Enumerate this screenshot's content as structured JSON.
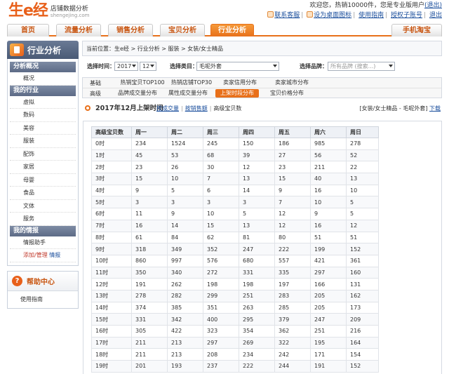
{
  "header": {
    "logo_main": "生e经",
    "logo_sub1": "店铺数据分析",
    "logo_sub2": "shengejing.com",
    "welcome": "欢迎您，热销10000件，您是专业版用户",
    "welcome_link": "(退出)",
    "links": [
      "联系客服",
      "设为桌面图标",
      "使用指南",
      "授权子账号",
      "退出"
    ]
  },
  "nav": {
    "tabs": [
      "首页",
      "流量分析",
      "销售分析",
      "宝贝分析",
      "行业分析"
    ],
    "active": "行业分析",
    "right_tab": "手机淘宝"
  },
  "sidebar": {
    "title": "行业分析",
    "groups": [
      {
        "head": "分析概况",
        "items": [
          "概况"
        ]
      },
      {
        "head": "我的行业",
        "items": [
          "虚拟",
          "数码",
          "美容",
          "服装",
          "配饰",
          "家居",
          "母婴",
          "食品",
          "文体",
          "服务"
        ]
      },
      {
        "head": "我的情报",
        "items": [
          "情报助手"
        ]
      }
    ],
    "add_manage": "添加/管理",
    "add_manage_link": "情报"
  },
  "help": {
    "icon": "?",
    "title": "帮助中心",
    "item": "使用指南"
  },
  "breadcrumb": "当前位置：生e经 > 行业分析 > 服装 > 女装/女士精品",
  "filters": {
    "time_label": "选择时间：",
    "year": "2017",
    "month": "12",
    "category_label": "选择类目：",
    "category": "毛呢外套",
    "brand_label": "选择品牌：",
    "brand_placeholder": "所有品牌 (搜索...)"
  },
  "subtabs": {
    "basic_label": "基础",
    "basic": [
      "热销宝贝TOP100",
      "热销店铺TOP30",
      "卖家信用分布",
      "卖家城市分布"
    ],
    "advanced_label": "高级",
    "advanced": [
      "品牌成交量分布",
      "属性成交量分布",
      "上架时段分布",
      "宝贝价格分布"
    ],
    "active": "上架时段分布"
  },
  "section": {
    "title": "2017年12月上架时间",
    "links": [
      "按成交量",
      "按销售额",
      "高级宝贝数"
    ],
    "right_text": "[女装/女士精品 - 毛呢外套]",
    "download": "下载"
  },
  "table": {
    "headers": [
      "高级宝贝数",
      "周一",
      "周二",
      "周三",
      "周四",
      "周五",
      "周六",
      "周日"
    ],
    "rows": [
      [
        "0时",
        "234",
        "1524",
        "245",
        "150",
        "186",
        "985",
        "278"
      ],
      [
        "1时",
        "45",
        "53",
        "68",
        "39",
        "27",
        "56",
        "52"
      ],
      [
        "2时",
        "23",
        "26",
        "30",
        "12",
        "23",
        "211",
        "22"
      ],
      [
        "3时",
        "15",
        "10",
        "7",
        "13",
        "15",
        "40",
        "13"
      ],
      [
        "4时",
        "9",
        "5",
        "6",
        "14",
        "9",
        "16",
        "10"
      ],
      [
        "5时",
        "3",
        "3",
        "3",
        "3",
        "7",
        "10",
        "5"
      ],
      [
        "6时",
        "11",
        "9",
        "10",
        "5",
        "12",
        "9",
        "5"
      ],
      [
        "7时",
        "16",
        "14",
        "15",
        "13",
        "12",
        "16",
        "12"
      ],
      [
        "8时",
        "61",
        "84",
        "62",
        "81",
        "80",
        "51",
        "51"
      ],
      [
        "9时",
        "318",
        "349",
        "352",
        "247",
        "222",
        "199",
        "152"
      ],
      [
        "10时",
        "860",
        "997",
        "576",
        "680",
        "557",
        "421",
        "361"
      ],
      [
        "11时",
        "350",
        "340",
        "272",
        "331",
        "335",
        "297",
        "160"
      ],
      [
        "12时",
        "191",
        "262",
        "198",
        "198",
        "197",
        "166",
        "131"
      ],
      [
        "13时",
        "278",
        "282",
        "299",
        "251",
        "283",
        "205",
        "162"
      ],
      [
        "14时",
        "374",
        "385",
        "351",
        "263",
        "285",
        "205",
        "173"
      ],
      [
        "15时",
        "331",
        "342",
        "400",
        "295",
        "379",
        "247",
        "209"
      ],
      [
        "16时",
        "305",
        "422",
        "323",
        "354",
        "362",
        "251",
        "216"
      ],
      [
        "17时",
        "211",
        "213",
        "297",
        "269",
        "322",
        "195",
        "164"
      ],
      [
        "18时",
        "211",
        "213",
        "208",
        "234",
        "242",
        "171",
        "154"
      ],
      [
        "19时",
        "201",
        "193",
        "237",
        "222",
        "244",
        "191",
        "152"
      ]
    ]
  }
}
